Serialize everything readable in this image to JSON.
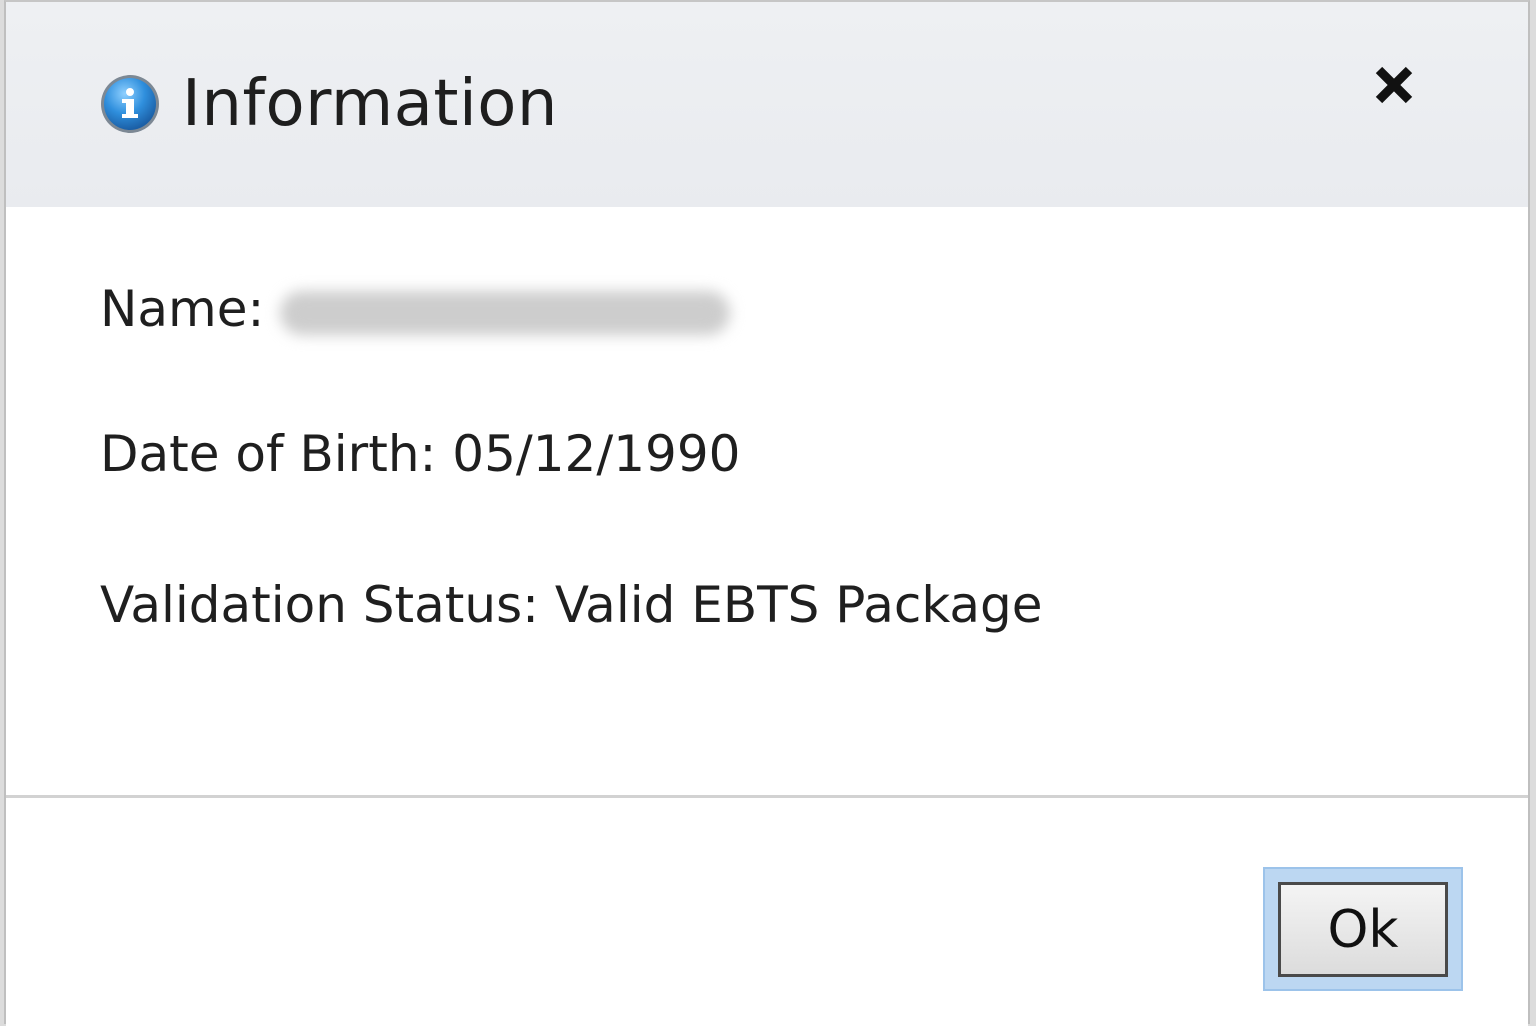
{
  "dialog": {
    "title": "Information",
    "icon": "info-icon",
    "close_icon": "close-icon"
  },
  "fields": {
    "name_label": "Name:",
    "dob_text": "Date of Birth: 05/12/1990",
    "status_text": "Validation Status: Valid EBTS Package"
  },
  "footer": {
    "ok_label": "Ok"
  },
  "colors": {
    "title_bar": "#eef0f3",
    "focus_ring": "#bcd7f2",
    "info_icon_blue": "#2f8fdd"
  }
}
